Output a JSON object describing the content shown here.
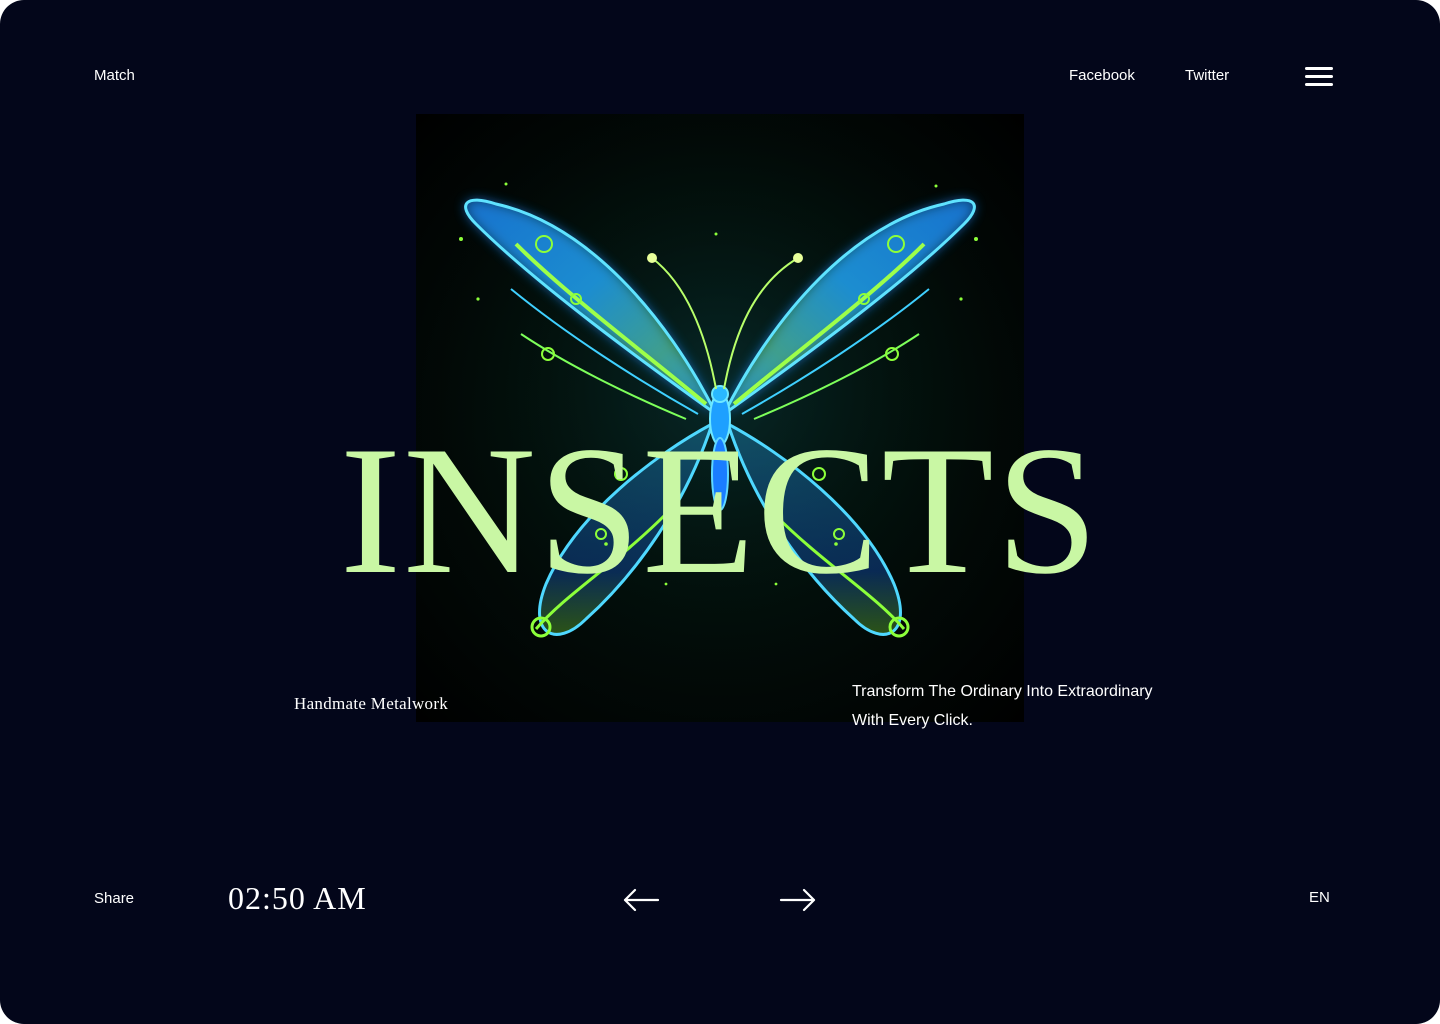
{
  "header": {
    "brand_link": "Match",
    "social_links": [
      "Facebook",
      "Twitter"
    ],
    "menu_icon": "hamburger-menu-icon"
  },
  "hero": {
    "title": "INSECTS",
    "tagline": "Handmate Metalwork",
    "description_line1": "Transform The Ordinary Into Extraordinary",
    "description_line2": "With Every Click.",
    "image_subject": "glowing neon butterfly"
  },
  "footer": {
    "share_label": "Share",
    "time": "02:50 AM",
    "prev_icon": "arrow-left-icon",
    "next_icon": "arrow-right-icon",
    "language": "EN"
  },
  "colors": {
    "background": "#03061a",
    "accent": "#c9f7a4",
    "text": "#ffffff",
    "butterfly_blue": "#2ab8ff",
    "butterfly_green": "#8cff3a"
  }
}
